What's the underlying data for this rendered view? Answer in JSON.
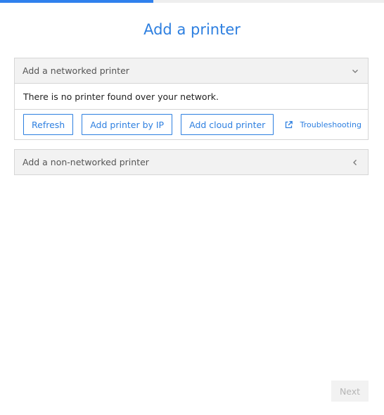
{
  "progress": {
    "fraction": 0.4,
    "color": "#2f80ed"
  },
  "title": "Add a printer",
  "networked": {
    "header": "Add a networked printer",
    "expanded": true,
    "message": "There is no printer found over your network.",
    "buttons": {
      "refresh": "Refresh",
      "by_ip": "Add printer by IP",
      "cloud": "Add cloud printer"
    },
    "troubleshooting": "Troubleshooting"
  },
  "non_networked": {
    "header": "Add a non-networked printer",
    "expanded": false
  },
  "footer": {
    "next_label": "Next",
    "next_enabled": false
  },
  "colors": {
    "accent": "#2d7fe0",
    "panel_header": "#f2f2f2",
    "border": "#d6d6d6"
  },
  "icons": {
    "networked_chevron": "chevron-down-icon",
    "non_networked_chevron": "chevron-left-icon",
    "troubleshooting": "external-link-icon"
  }
}
